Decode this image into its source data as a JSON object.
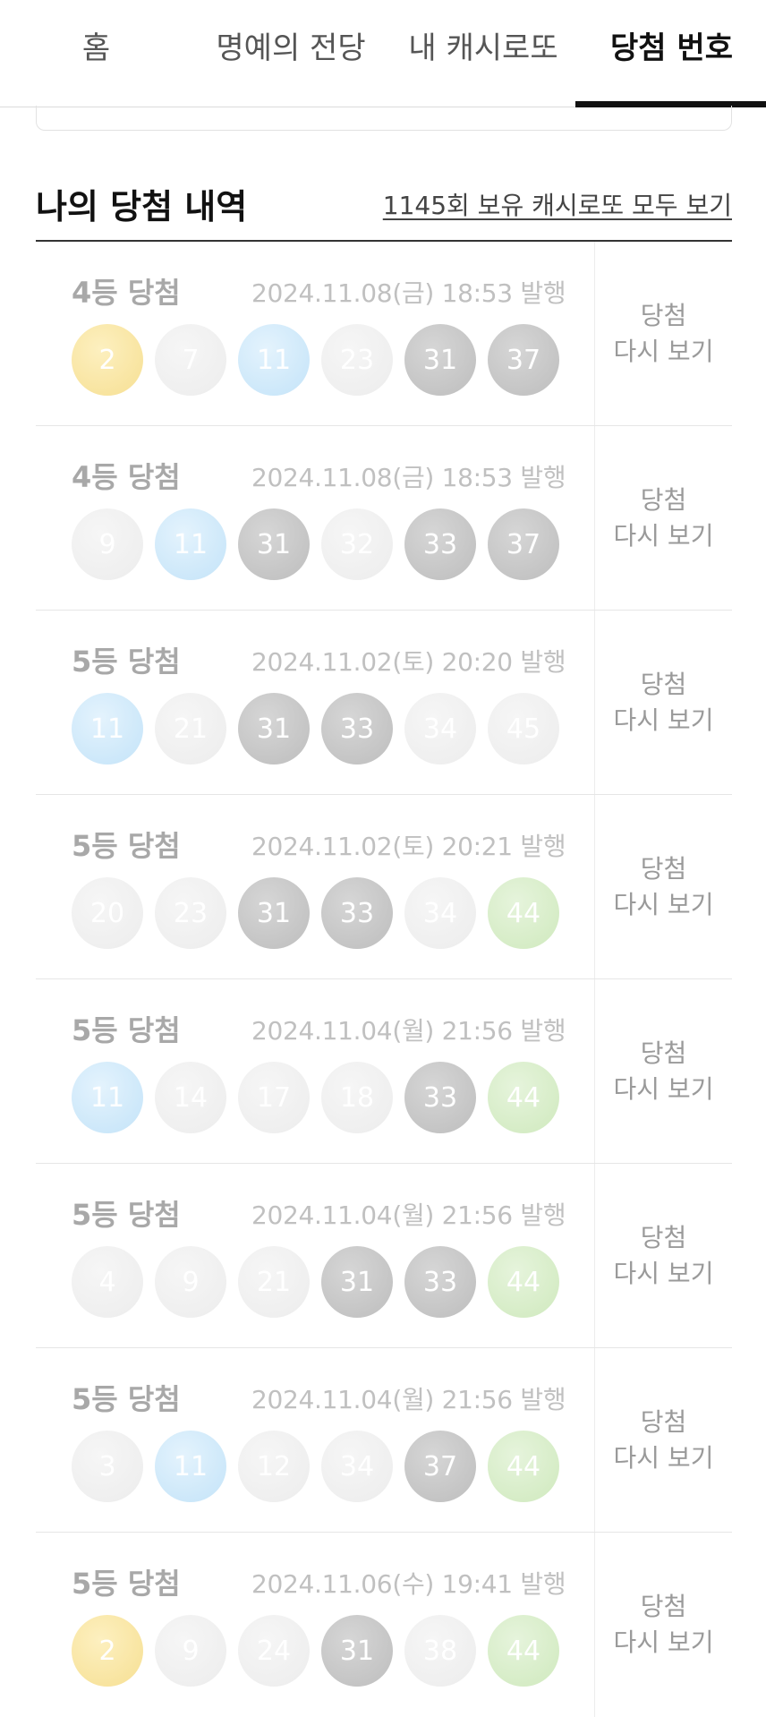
{
  "tabs": [
    {
      "label": "홈",
      "active": false
    },
    {
      "label": "명예의 전당",
      "active": false
    },
    {
      "label": "내 캐시로또",
      "active": false
    },
    {
      "label": "당첨 번호",
      "active": true
    }
  ],
  "section": {
    "title": "나의 당첨 내역",
    "see_all_link": "1145회 보유 캐시로또 모두 보기"
  },
  "replay_label": {
    "line1": "당첨",
    "line2": "다시 보기"
  },
  "ball_colors": {
    "yellow": "#f6df92",
    "blue": "#c3e3f8",
    "green": "#cfe9bd",
    "gray": "#bdbdbd",
    "faint": "#ececec"
  },
  "wins": [
    {
      "rank": "4등 당첨",
      "issued": "2024.11.08(금) 18:53 발행",
      "balls": [
        {
          "n": "2",
          "color": "yellow"
        },
        {
          "n": "7",
          "color": "faint"
        },
        {
          "n": "11",
          "color": "blue"
        },
        {
          "n": "23",
          "color": "faint"
        },
        {
          "n": "31",
          "color": "gray"
        },
        {
          "n": "37",
          "color": "gray"
        }
      ]
    },
    {
      "rank": "4등 당첨",
      "issued": "2024.11.08(금) 18:53 발행",
      "balls": [
        {
          "n": "9",
          "color": "faint"
        },
        {
          "n": "11",
          "color": "blue"
        },
        {
          "n": "31",
          "color": "gray"
        },
        {
          "n": "32",
          "color": "faint"
        },
        {
          "n": "33",
          "color": "gray"
        },
        {
          "n": "37",
          "color": "gray"
        }
      ]
    },
    {
      "rank": "5등 당첨",
      "issued": "2024.11.02(토) 20:20 발행",
      "balls": [
        {
          "n": "11",
          "color": "blue"
        },
        {
          "n": "21",
          "color": "faint"
        },
        {
          "n": "31",
          "color": "gray"
        },
        {
          "n": "33",
          "color": "gray"
        },
        {
          "n": "34",
          "color": "faint"
        },
        {
          "n": "45",
          "color": "faint"
        }
      ]
    },
    {
      "rank": "5등 당첨",
      "issued": "2024.11.02(토) 20:21 발행",
      "balls": [
        {
          "n": "20",
          "color": "faint"
        },
        {
          "n": "23",
          "color": "faint"
        },
        {
          "n": "31",
          "color": "gray"
        },
        {
          "n": "33",
          "color": "gray"
        },
        {
          "n": "34",
          "color": "faint"
        },
        {
          "n": "44",
          "color": "green"
        }
      ]
    },
    {
      "rank": "5등 당첨",
      "issued": "2024.11.04(월) 21:56 발행",
      "balls": [
        {
          "n": "11",
          "color": "blue"
        },
        {
          "n": "14",
          "color": "faint"
        },
        {
          "n": "17",
          "color": "faint"
        },
        {
          "n": "18",
          "color": "faint"
        },
        {
          "n": "33",
          "color": "gray"
        },
        {
          "n": "44",
          "color": "green"
        }
      ]
    },
    {
      "rank": "5등 당첨",
      "issued": "2024.11.04(월) 21:56 발행",
      "balls": [
        {
          "n": "4",
          "color": "faint"
        },
        {
          "n": "9",
          "color": "faint"
        },
        {
          "n": "21",
          "color": "faint"
        },
        {
          "n": "31",
          "color": "gray"
        },
        {
          "n": "33",
          "color": "gray"
        },
        {
          "n": "44",
          "color": "green"
        }
      ]
    },
    {
      "rank": "5등 당첨",
      "issued": "2024.11.04(월) 21:56 발행",
      "balls": [
        {
          "n": "3",
          "color": "faint"
        },
        {
          "n": "11",
          "color": "blue"
        },
        {
          "n": "12",
          "color": "faint"
        },
        {
          "n": "34",
          "color": "faint"
        },
        {
          "n": "37",
          "color": "gray"
        },
        {
          "n": "44",
          "color": "green"
        }
      ]
    },
    {
      "rank": "5등 당첨",
      "issued": "2024.11.06(수) 19:41 발행",
      "balls": [
        {
          "n": "2",
          "color": "yellow"
        },
        {
          "n": "9",
          "color": "faint"
        },
        {
          "n": "24",
          "color": "faint"
        },
        {
          "n": "31",
          "color": "gray"
        },
        {
          "n": "38",
          "color": "faint"
        },
        {
          "n": "44",
          "color": "green"
        }
      ]
    }
  ]
}
